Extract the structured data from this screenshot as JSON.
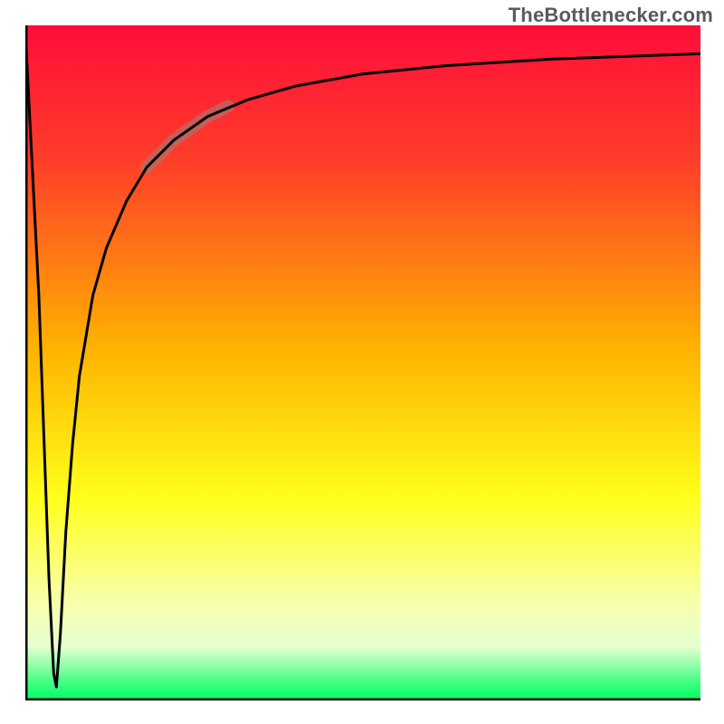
{
  "attribution": "TheBottlenecker.com",
  "chart_data": {
    "type": "line",
    "title": "",
    "xlabel": "",
    "ylabel": "",
    "xlim": [
      0,
      100
    ],
    "ylim": [
      0,
      100
    ],
    "gradient_stops": [
      {
        "offset": 0,
        "color": "#ff0d3a"
      },
      {
        "offset": 20,
        "color": "#ff3d29"
      },
      {
        "offset": 48,
        "color": "#ffb300"
      },
      {
        "offset": 70,
        "color": "#ffff1a"
      },
      {
        "offset": 85,
        "color": "#f8ffa8"
      },
      {
        "offset": 92,
        "color": "#e6ffd0"
      },
      {
        "offset": 98,
        "color": "#2eff7a"
      },
      {
        "offset": 100,
        "color": "#00ff66"
      }
    ],
    "series": [
      {
        "name": "bottleneck-curve",
        "stroke": "#000000",
        "stroke_width": 3,
        "x": [
          0,
          2,
          3.5,
          4.2,
          4.6,
          5.2,
          6,
          7,
          8,
          10,
          12,
          15,
          18,
          22,
          27,
          33,
          40,
          50,
          62,
          78,
          100
        ],
        "y": [
          99,
          60,
          18,
          4,
          2,
          10,
          25,
          38,
          48,
          60,
          67,
          74,
          79,
          83,
          86.5,
          89,
          91,
          92.8,
          94,
          95,
          95.8
        ]
      }
    ],
    "highlight_segment": {
      "stroke": "#a8776e",
      "stroke_width": 14,
      "opacity": 0.65,
      "x": [
        18,
        22,
        27,
        30
      ],
      "y": [
        79,
        83,
        86.5,
        88
      ]
    },
    "axes": {
      "left": {
        "stroke": "#000000",
        "width": 5
      },
      "bottom": {
        "stroke": "#000000",
        "width": 5
      }
    }
  }
}
